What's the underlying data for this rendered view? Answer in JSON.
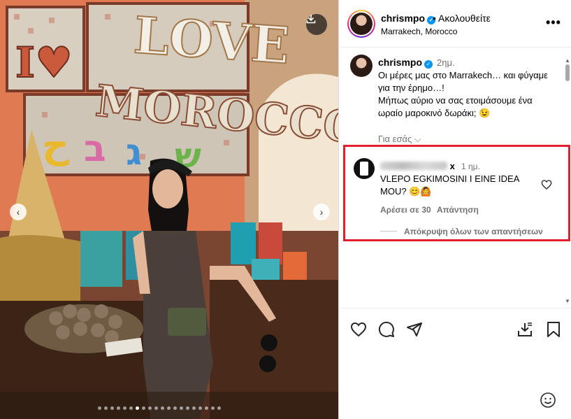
{
  "photo": {
    "sign_words": [
      "LOVE",
      "MOROCCO",
      "I♥"
    ],
    "slide_count": 20,
    "active_slide": 6
  },
  "header": {
    "username": "chrismpo",
    "follow_status": "• Ακολουθείτε",
    "location": "Marrakech, Morocco"
  },
  "caption": {
    "username": "chrismpo",
    "time": "2ημ.",
    "lines": [
      "Οι μέρες μας στο Marrakech… και φύγαμε για την έρημο…!",
      "Μήπως αύριο να σας ετοιμάσουμε ένα ωραίο μαροκινό δωράκι; 😉"
    ],
    "for_you": "Για εσάς ⌵"
  },
  "comment": {
    "username_suffix": "x",
    "time": "1 ημ.",
    "text": "VLEPO EGKIMOSINI I EINE IDEA MOU? 😊🙆",
    "likes": "Αρέσει σε 30",
    "reply": "Απάντηση",
    "hide_replies": "Απόκρυψη όλων των απαντήσεων"
  },
  "colors": {
    "highlight_border": "#e0212d",
    "verified": "#0095f6",
    "muted_text": "#737373"
  },
  "icons": [
    "download-icon",
    "chevron-left-icon",
    "chevron-right-icon",
    "verified-icon",
    "more-icon",
    "heart-icon",
    "comment-icon",
    "share-icon",
    "save-icon",
    "emoji-icon"
  ]
}
